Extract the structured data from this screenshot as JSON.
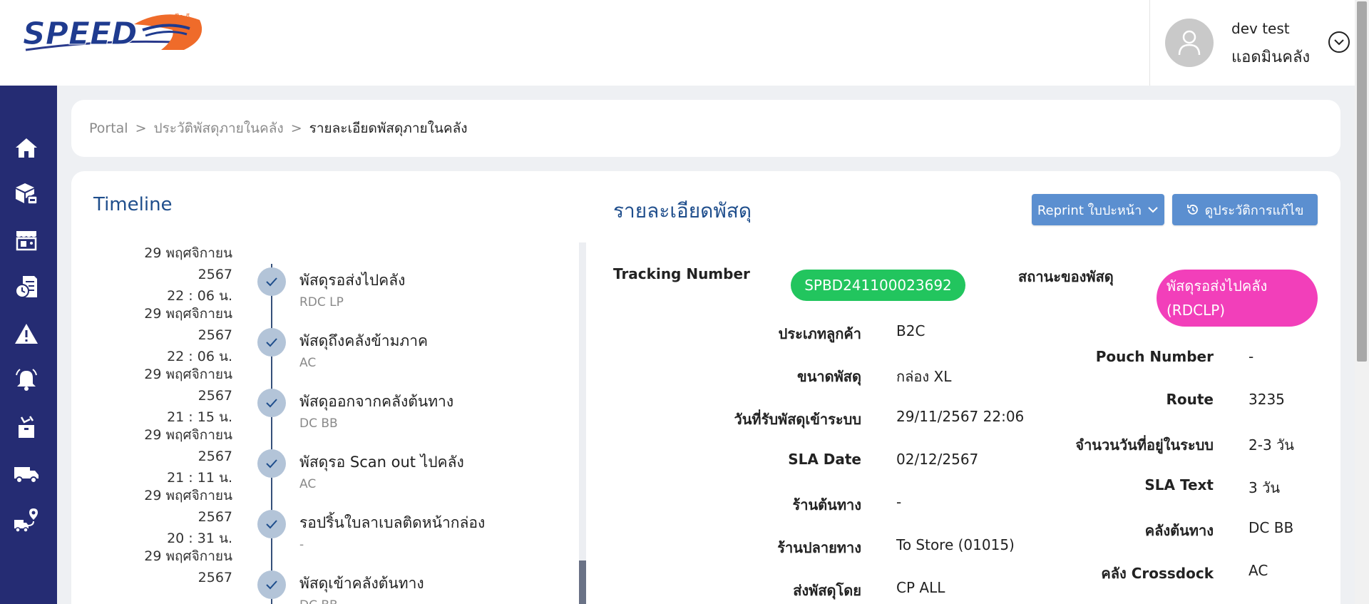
{
  "header": {
    "logo_text": "SPEED-D",
    "user": {
      "name": "dev test",
      "role": "แอดมินคลัง"
    }
  },
  "sidebar": {
    "items": [
      {
        "icon": "home-icon"
      },
      {
        "icon": "parcel-icon"
      },
      {
        "icon": "store-icon"
      },
      {
        "icon": "report-history-icon"
      },
      {
        "icon": "warning-icon"
      },
      {
        "icon": "bell-icon"
      },
      {
        "icon": "return-parcel-icon"
      },
      {
        "icon": "truck-icon"
      },
      {
        "icon": "route-icon"
      }
    ]
  },
  "breadcrumb": [
    "Portal",
    "ประวัติพัสดุภายในคลัง",
    "รายละเอียดพัสดุภายในคลัง"
  ],
  "timeline": {
    "title": "Timeline",
    "items": [
      {
        "date": "29 พฤศจิกายน 2567",
        "time": "22 : 06 น.",
        "status": "พัสดุรอส่งไปคลัง",
        "location": "RDC LP"
      },
      {
        "date": "29 พฤศจิกายน 2567",
        "time": "22 : 06 น.",
        "status": "พัสดุถึงคลังข้ามภาค",
        "location": "AC"
      },
      {
        "date": "29 พฤศจิกายน 2567",
        "time": "21 : 15 น.",
        "status": "พัสดุออกจากคลังต้นทาง",
        "location": "DC BB"
      },
      {
        "date": "29 พฤศจิกายน 2567",
        "time": "21 : 11 น.",
        "status": "พัสดุรอ Scan out ไปคลัง",
        "location": "AC"
      },
      {
        "date": "29 พฤศจิกายน 2567",
        "time": "20 : 31 น.",
        "status": "รอปริ้นใบลาเบลติดหน้ากล่อง",
        "location": "-"
      },
      {
        "date": "29 พฤศจิกายน 2567",
        "time": "",
        "status": "พัสดุเข้าคลังต้นทาง",
        "location": "DC BB"
      }
    ]
  },
  "details": {
    "title": "รายละเอียดพัสดุ",
    "reprint_button": "Reprint ใบปะหน้า",
    "history_button": "ดูประวัติการแก้ไข",
    "tracking_label": "Tracking Number",
    "tracking_number": "SPBD241100023692",
    "status_label": "สถานะของพัสดุ",
    "status_value": "พัสดุรอส่งไปคลัง (RDCLP)",
    "left_rows": [
      {
        "label": "ประเภทลูกค้า",
        "value": "B2C"
      },
      {
        "label": "ขนาดพัสดุ",
        "value": "กล่อง XL"
      },
      {
        "label": "วันที่รับพัสดุเข้าระบบ",
        "value": "29/11/2567 22:06"
      },
      {
        "label": "SLA Date",
        "value": "02/12/2567"
      },
      {
        "label": "ร้านต้นทาง",
        "value": "-"
      },
      {
        "label": "ร้านปลายทาง",
        "value": "To Store (01015)"
      },
      {
        "label": "ส่งพัสดุโดย",
        "value": "CP ALL"
      }
    ],
    "right_rows": [
      {
        "label": "Pouch Number",
        "value": "-"
      },
      {
        "label": "Route",
        "value": "3235"
      },
      {
        "label": "จำนวนวันที่อยู่ในระบบ",
        "value": "2-3 วัน"
      },
      {
        "label": "SLA Text",
        "value": "3 วัน"
      },
      {
        "label": "คลังต้นทาง",
        "value": "DC BB"
      },
      {
        "label": "คลัง Crossdock",
        "value": "AC"
      }
    ]
  },
  "colors": {
    "sidebar": "#252c73",
    "title_blue": "#1f4e8c",
    "button_blue": "#5b8fd0",
    "tracking_green": "#22c55e",
    "status_pink": "#f23fba"
  }
}
